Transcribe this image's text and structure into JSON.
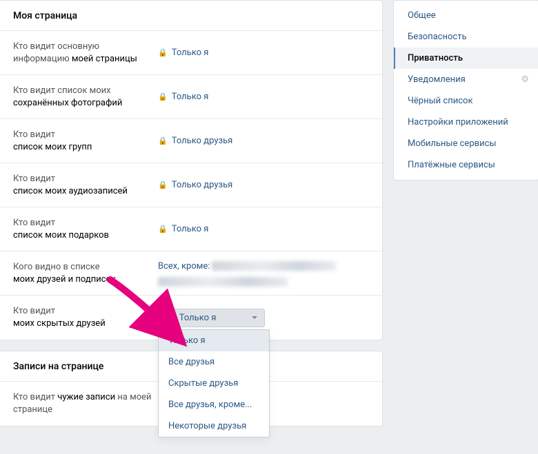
{
  "sidebar": {
    "items": [
      {
        "label": "Общее"
      },
      {
        "label": "Безопасность"
      },
      {
        "label": "Приватность"
      },
      {
        "label": "Уведомления"
      },
      {
        "label": "Чёрный список"
      },
      {
        "label": "Настройки приложений"
      },
      {
        "label": "Мобильные сервисы"
      },
      {
        "label": "Платёжные сервисы"
      }
    ]
  },
  "section1": {
    "title": "Моя страница",
    "rows": [
      {
        "label_pre": "Кто видит основную информацию ",
        "label_bold": "моей страницы",
        "value": "Только я",
        "lock": true
      },
      {
        "label_pre": "Кто видит список моих ",
        "label_bold": "сохранённых фотографий",
        "value": "Только я",
        "lock": true
      },
      {
        "label_pre": "Кто видит",
        "label_bold": "список моих групп",
        "value": "Только друзья",
        "lock": true,
        "two_line": true
      },
      {
        "label_pre": "Кто видит",
        "label_bold": "список моих аудиозаписей",
        "value": "Только друзья",
        "lock": true,
        "two_line": true
      },
      {
        "label_pre": "Кто видит",
        "label_bold": "список моих подарков",
        "value": "Только я",
        "lock": true,
        "two_line": true
      },
      {
        "label_pre": "Кого видно в списке",
        "label_bold": "моих друзей и подписок",
        "value_prefix": "Всех, кроме:",
        "two_line": true
      },
      {
        "label_pre": "Кто видит",
        "label_bold": "моих скрытых друзей",
        "two_line": true
      }
    ]
  },
  "dropdown": {
    "selected": "Только я",
    "options": [
      "Только я",
      "Все друзья",
      "Скрытые друзья",
      "Все друзья, кроме...",
      "Некоторые друзья"
    ]
  },
  "section2": {
    "title": "Записи на странице",
    "rows": [
      {
        "label_pre": "Кто видит ",
        "label_bold": "чужие записи",
        "label_post": " на моей странице"
      }
    ]
  }
}
